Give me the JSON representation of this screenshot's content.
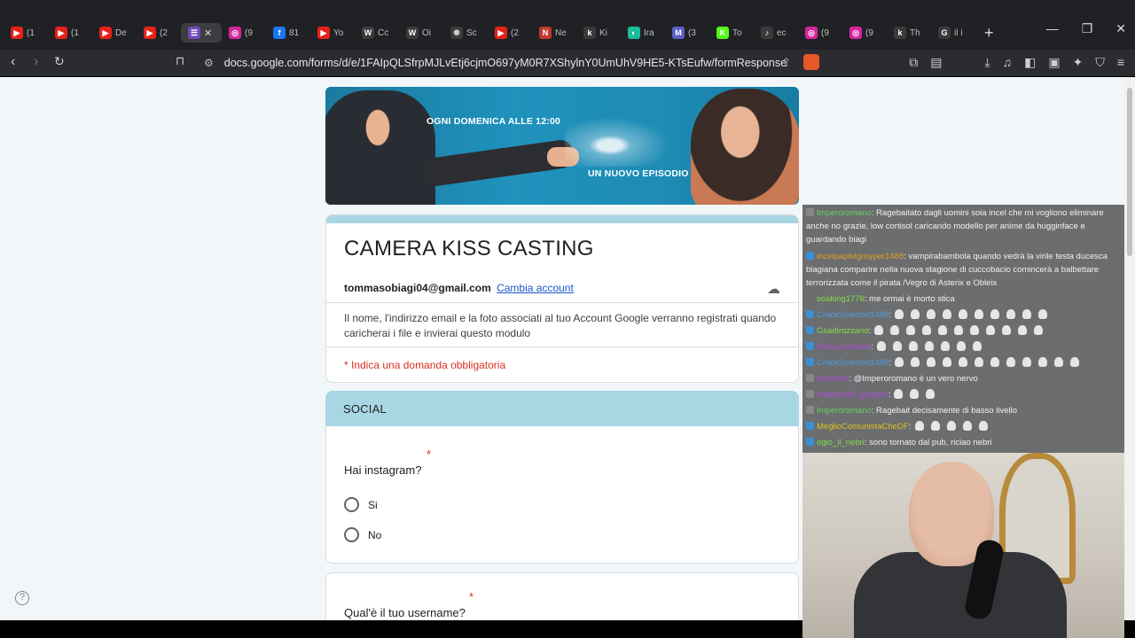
{
  "browser": {
    "tabs": [
      {
        "icon": "youtube-icon",
        "color": "#e62117",
        "glyph": "▶",
        "title": "(1"
      },
      {
        "icon": "youtube-icon",
        "color": "#e62117",
        "glyph": "▶",
        "title": "(1"
      },
      {
        "icon": "youtube-icon",
        "color": "#e62117",
        "glyph": "▶",
        "title": "De"
      },
      {
        "icon": "youtube-icon",
        "color": "#e62117",
        "glyph": "▶",
        "title": "(2"
      },
      {
        "icon": "google-forms-icon",
        "color": "#7248b9",
        "glyph": "☰",
        "title": "",
        "active": true
      },
      {
        "icon": "instagram-icon",
        "color": "#d6249f",
        "glyph": "◎",
        "title": "(9"
      },
      {
        "icon": "facebook-icon",
        "color": "#1877f2",
        "glyph": "f",
        "title": "81"
      },
      {
        "icon": "youtube-icon",
        "color": "#e62117",
        "glyph": "▶",
        "title": "Yo"
      },
      {
        "icon": "wikipedia-icon",
        "color": "#ffffff",
        "glyph": "W",
        "title": "Cc"
      },
      {
        "icon": "wikipedia-icon",
        "color": "#ffffff",
        "glyph": "W",
        "title": "Oi"
      },
      {
        "icon": "openai-icon",
        "color": "#cccccc",
        "glyph": "✺",
        "title": "Sc"
      },
      {
        "icon": "youtube-icon",
        "color": "#e62117",
        "glyph": "▶",
        "title": "(2"
      },
      {
        "icon": "news-icon",
        "color": "#c0392b",
        "glyph": "N",
        "title": "Ne"
      },
      {
        "icon": "kick-icon",
        "color": "#ffffff",
        "glyph": "k",
        "title": "Ki"
      },
      {
        "icon": "web-icon",
        "color": "#1abc9c",
        "glyph": "◐",
        "title": "Ira"
      },
      {
        "icon": "mail-icon",
        "color": "#5b5fc7",
        "glyph": "M",
        "title": "(3"
      },
      {
        "icon": "kick-green-icon",
        "color": "#53fc18",
        "glyph": "K",
        "title": "To"
      },
      {
        "icon": "tiktok-icon",
        "color": "#ffffff",
        "glyph": "♪",
        "title": "ec"
      },
      {
        "icon": "instagram-icon",
        "color": "#d6249f",
        "glyph": "◎",
        "title": "(9"
      },
      {
        "icon": "instagram-icon",
        "color": "#d6249f",
        "glyph": "◎",
        "title": "(9"
      },
      {
        "icon": "kick-icon",
        "color": "#ffffff",
        "glyph": "k",
        "title": "Th"
      },
      {
        "icon": "google-icon",
        "color": "#ffffff",
        "glyph": "G",
        "title": "il i"
      }
    ],
    "url": "docs.google.com/forms/d/e/1FAIpQLSfrpMJLvEtj6cjmO697yM0R7XShylnY0UmUhV9HE5-KTsEufw/formResponse",
    "new_tab": "+",
    "extension_badge": "1"
  },
  "banner": {
    "line1": "OGNI DOMENICA ALLE 12:00",
    "line2": "UN NUOVO EPISODIO"
  },
  "form": {
    "title": "CAMERA KISS CASTING",
    "email": "tommasobiagi04@gmail.com",
    "switch_account": "Cambia account",
    "notice": "Il nome, l'indirizzo email e la foto associati al tuo Account Google verranno registrati quando caricherai i file e invierai questo modulo",
    "required_note": "* Indica una domanda obbligatoria",
    "section_title": "SOCIAL",
    "q1": {
      "label": "Hai instagram?",
      "star": "*",
      "options": [
        "Si",
        "No"
      ]
    },
    "q2": {
      "label": "Qual'è il tuo username?",
      "star": "*"
    },
    "help": "?"
  },
  "chat": [
    {
      "user": "Imperoromano",
      "user_color": "#5fd35f",
      "badge_color": "#888888",
      "text": ": Ragebaitato dagli uomini soia incel che mi vogliono eliminare anche no grazie, low cortisol caricando modello per anime da hugginface e guardando biagi",
      "wrap": true
    },
    {
      "user": "incelpapistgroyper1488",
      "user_color": "#e0a020",
      "badge_color": "#3a8fd8",
      "text": ": vampirabambola quando vedrà la virile testa ducesca biagiana comparire nella nuova stagione di cuccobacio comincerà a balbettare terrorizzata come il pirata /Vegro di Asterix e Obleix",
      "wrap": true
    },
    {
      "user": "soaking1776",
      "user_color": "#7ee04a",
      "badge_color": "",
      "text": ": me ormai è morto stica",
      "wrap": false
    },
    {
      "user": "CrackSparrow1488",
      "user_color": "#4a9be0",
      "badge_color": "#3a8fd8",
      "text": ":",
      "emotes": 10,
      "wrap": false
    },
    {
      "user": "Gsadirozzano",
      "user_color": "#7ee04a",
      "badge_color": "#3a8fd8",
      "text": ":",
      "emotes": 11,
      "wrap": false
    },
    {
      "user": "RexLucumane",
      "user_color": "#b04ae0",
      "badge_color": "#3a8fd8",
      "text": ":",
      "emotes": 7,
      "wrap": false
    },
    {
      "user": "CrackSparrow1488",
      "user_color": "#4a9be0",
      "badge_color": "#3a8fd8",
      "text": ":",
      "emotes": 12,
      "wrap": false
    },
    {
      "user": "carmelm",
      "user_color": "#b04ae0",
      "badge_color": "#888888",
      "text": ": @Imperoromano è un vero nervo",
      "wrap": false
    },
    {
      "user": "seabjee39_gripppn",
      "user_color": "#b04ae0",
      "badge_color": "#888888",
      "text": ":",
      "emotes": 3,
      "wrap": false
    },
    {
      "user": "Imperoromano",
      "user_color": "#5fd35f",
      "badge_color": "#888888",
      "text": ": Ragebait decisamente di basso livello",
      "wrap": false
    },
    {
      "user": "MeglioComunistaCheOF",
      "user_color": "#e0c020",
      "badge_color": "#3a8fd8",
      "text": ":",
      "emotes": 5,
      "wrap": false
    },
    {
      "user": "ogio_il_nebri",
      "user_color": "#7ee04a",
      "badge_color": "#3a8fd8",
      "text": ": sono tornato dal pub, riciao nebri",
      "wrap": false
    }
  ]
}
